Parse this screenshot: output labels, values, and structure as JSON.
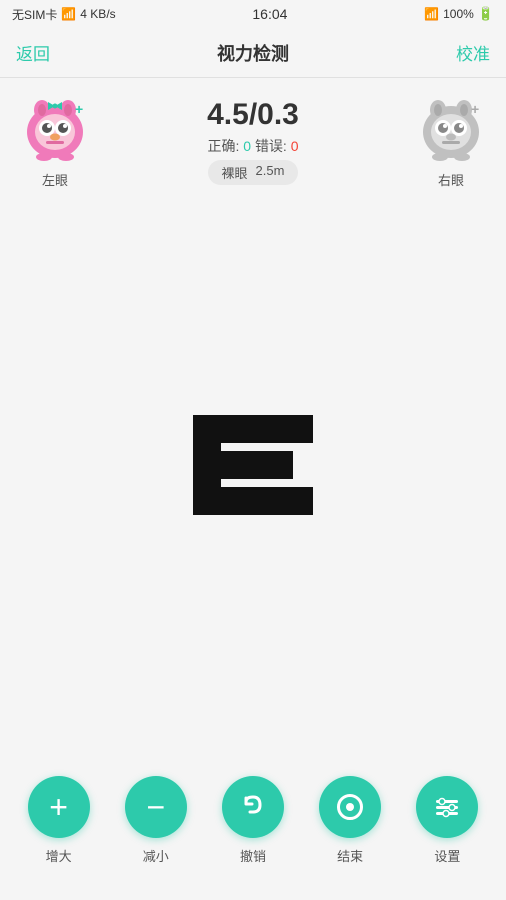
{
  "statusBar": {
    "carrier": "无SIM卡",
    "wifi": "WiFi",
    "speed": "4 KB/s",
    "time": "16:04",
    "bluetooth": "BT",
    "battery": "100%"
  },
  "navBar": {
    "backLabel": "返回",
    "title": "视力检测",
    "calibrateLabel": "校准"
  },
  "scorePanel": {
    "scoreValue": "4.5/0.3",
    "correctLabel": "正确:",
    "correctValue": "0",
    "wrongLabel": "错误:",
    "wrongValue": "0",
    "tagNaked": "裸眼",
    "tagDistance": "2.5m",
    "leftEyeLabel": "左眼",
    "rightEyeLabel": "右眼"
  },
  "toolbar": {
    "buttons": [
      {
        "id": "increase",
        "label": "增大",
        "icon": "plus"
      },
      {
        "id": "decrease",
        "label": "减小",
        "icon": "minus"
      },
      {
        "id": "undo",
        "label": "撤销",
        "icon": "undo"
      },
      {
        "id": "end",
        "label": "结束",
        "icon": "end"
      },
      {
        "id": "settings",
        "label": "设置",
        "icon": "settings"
      }
    ]
  },
  "colors": {
    "accent": "#2dcaab",
    "danger": "#f44336",
    "textPrimary": "#333333",
    "textSecondary": "#555555"
  }
}
